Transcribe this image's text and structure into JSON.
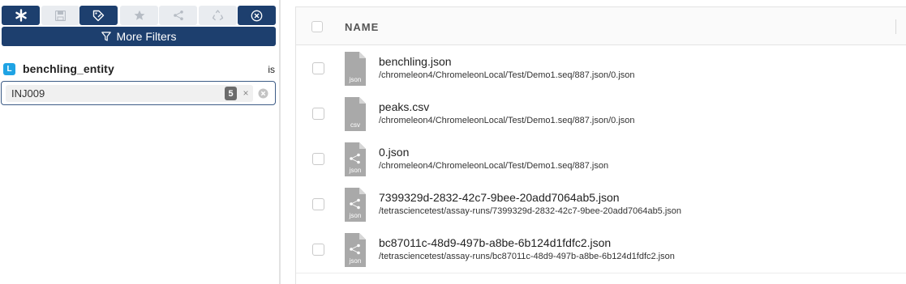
{
  "toolbar": {
    "buttons": [
      {
        "name": "asterisk-icon",
        "state": "active"
      },
      {
        "name": "save-icon",
        "state": "disabled"
      },
      {
        "name": "tag-edit-icon",
        "state": "active"
      },
      {
        "name": "star-icon",
        "state": "disabled"
      },
      {
        "name": "share-icon",
        "state": "disabled"
      },
      {
        "name": "recycle-icon",
        "state": "disabled"
      },
      {
        "name": "close-circle-icon",
        "state": "active"
      }
    ],
    "more_filters_label": "More Filters",
    "more_filters_icon": "funnel-icon"
  },
  "filter": {
    "badge": "L",
    "field": "benchling_entity",
    "operator": "is",
    "tag_value": "INJ009",
    "tag_count": "5",
    "tag_remove": "×"
  },
  "table": {
    "header_name": "NAME",
    "rows": [
      {
        "name": "benchling.json",
        "path": "/chromeleon4/ChromeleonLocal/Test/Demo1.seq/887.json/0.json",
        "icon_label": "json",
        "icon_type": "file-icon"
      },
      {
        "name": "peaks.csv",
        "path": "/chromeleon4/ChromeleonLocal/Test/Demo1.seq/887.json/0.json",
        "icon_label": "csv",
        "icon_type": "file-icon"
      },
      {
        "name": "0.json",
        "path": "/chromeleon4/ChromeleonLocal/Test/Demo1.seq/887.json",
        "icon_label": "json",
        "icon_type": "linked-file-icon"
      },
      {
        "name": "7399329d-2832-42c7-9bee-20add7064ab5.json",
        "path": "/tetrasciencetest/assay-runs/7399329d-2832-42c7-9bee-20add7064ab5.json",
        "icon_label": "json",
        "icon_type": "linked-file-icon"
      },
      {
        "name": "bc87011c-48d9-497b-a8be-6b124d1fdfc2.json",
        "path": "/tetrasciencetest/assay-runs/bc87011c-48d9-497b-a8be-6b124d1fdfc2.json",
        "icon_label": "json",
        "icon_type": "linked-file-icon"
      }
    ]
  },
  "colors": {
    "primary": "#1d3f6e",
    "badge": "#1fa3e4",
    "icon_gray": "#a9a9a9"
  }
}
